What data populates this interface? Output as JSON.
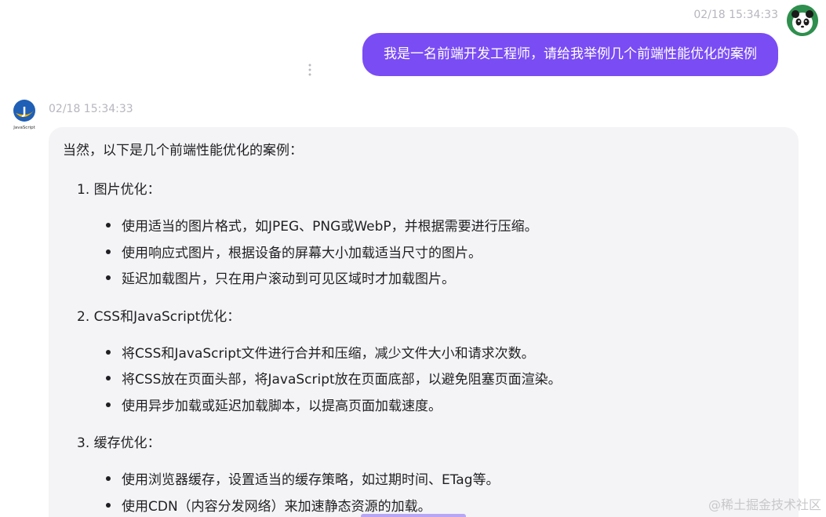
{
  "user_message": {
    "timestamp": "02/18 15:34:33",
    "text": "我是一名前端开发工程师，请给我举例几个前端性能优化的案例",
    "avatar_icon": "panda-avatar-icon"
  },
  "bot_message": {
    "timestamp": "02/18 15:34:33",
    "avatar_icon": "javascript-logo-icon",
    "intro": "当然，以下是几个前端性能优化的案例：",
    "sections": [
      {
        "title": "1. 图片优化：",
        "bullets": [
          "使用适当的图片格式，如JPEG、PNG或WebP，并根据需要进行压缩。",
          "使用响应式图片，根据设备的屏幕大小加载适当尺寸的图片。",
          "延迟加载图片，只在用户滚动到可见区域时才加载图片。"
        ]
      },
      {
        "title": "2. CSS和JavaScript优化：",
        "bullets": [
          "将CSS和JavaScript文件进行合并和压缩，减少文件大小和请求次数。",
          "将CSS放在页面头部，将JavaScript放在页面底部，以避免阻塞页面渲染。",
          "使用异步加载或延迟加载脚本，以提高页面加载速度。"
        ]
      },
      {
        "title": "3. 缓存优化：",
        "bullets": [
          "使用浏览器缓存，设置适当的缓存策略，如过期时间、ETag等。",
          "使用CDN（内容分发网络）来加速静态资源的加载。"
        ]
      }
    ]
  },
  "watermark": "@稀土掘金技术社区",
  "colors": {
    "user_bubble": "#7a4cf4",
    "bot_bubble": "#f4f4f6",
    "timestamp": "#b6b6be"
  }
}
